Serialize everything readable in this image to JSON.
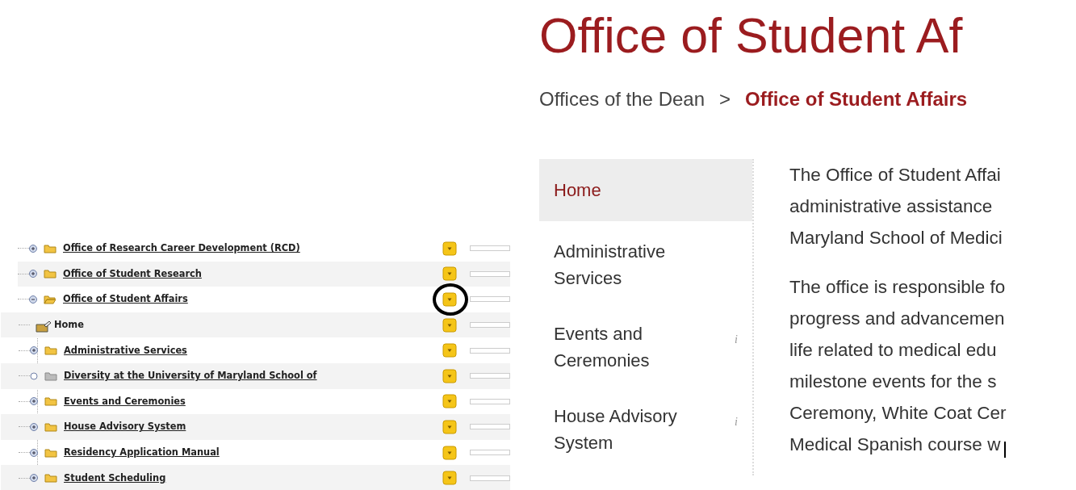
{
  "tree": [
    {
      "label": "Office of Research Career Development (RCD)",
      "kind": "folder",
      "expanded": false,
      "empty": false,
      "link": true,
      "circled": false
    },
    {
      "label": "Office of Student Research",
      "kind": "folder",
      "expanded": false,
      "empty": false,
      "link": true,
      "circled": false
    },
    {
      "label": "Office of Student Affairs",
      "kind": "folder",
      "expanded": true,
      "empty": false,
      "link": true,
      "circled": true,
      "children": [
        {
          "label": "Home",
          "kind": "page",
          "link": false,
          "circled": false
        },
        {
          "label": "Administrative Services",
          "kind": "folder",
          "expanded": false,
          "empty": false,
          "link": true,
          "circled": false
        },
        {
          "label": "Diversity at the University of Maryland School of",
          "kind": "folder",
          "empty": true,
          "link": true,
          "circled": false
        },
        {
          "label": "Events and Ceremonies",
          "kind": "folder",
          "expanded": false,
          "empty": false,
          "link": true,
          "circled": false
        },
        {
          "label": "House Advisory System",
          "kind": "folder",
          "expanded": false,
          "empty": false,
          "link": true,
          "circled": false
        },
        {
          "label": "Residency Application Manual",
          "kind": "folder",
          "expanded": false,
          "empty": false,
          "link": true,
          "circled": false
        },
        {
          "label": "Student Scheduling",
          "kind": "folder",
          "expanded": false,
          "empty": false,
          "link": true,
          "circled": false
        }
      ]
    }
  ],
  "page": {
    "title": "Office of Student Af",
    "breadcrumb": [
      {
        "label": "Offices of the Dean",
        "current": false
      },
      {
        "label": "Office of Student Affairs",
        "current": true
      }
    ],
    "breadcrumb_separator": ">",
    "nav": [
      {
        "label": "Home",
        "selected": true
      },
      {
        "label": "Administrative Services",
        "selected": false
      },
      {
        "label": "Events and Ceremonies",
        "selected": false,
        "hint": "i"
      },
      {
        "label": "House Advisory System",
        "selected": false,
        "hint": "i"
      }
    ],
    "paragraphs": [
      [
        "The Office of Student Affai",
        "administrative assistance",
        "Maryland School of Medici"
      ],
      [
        "The office is responsible fo",
        "progress and advancemen",
        "life related to medical edu",
        "milestone events for the s",
        "Ceremony, White Coat Cer",
        "Medical Spanish course w"
      ]
    ]
  }
}
